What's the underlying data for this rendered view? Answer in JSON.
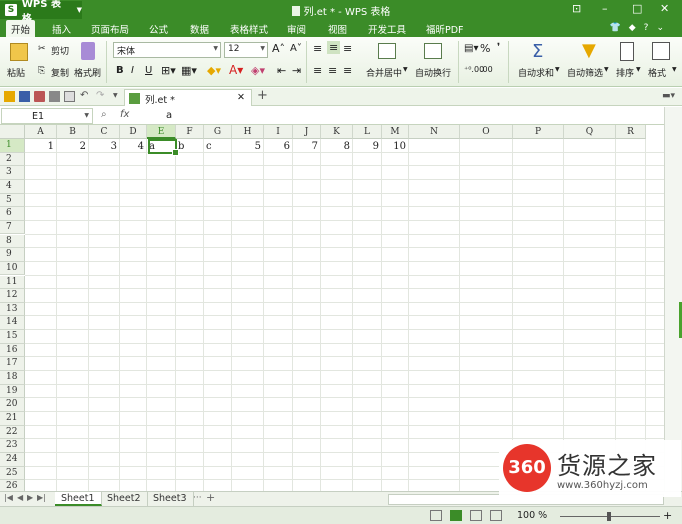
{
  "title_bar": {
    "app_name": "WPS 表格",
    "logo_glyph": "S",
    "document_title": "列.et * - WPS 表格"
  },
  "menu": {
    "tabs": [
      "开始",
      "插入",
      "页面布局",
      "公式",
      "数据",
      "表格样式",
      "审阅",
      "视图",
      "开发工具",
      "福昕PDF"
    ],
    "active_tab": "开始"
  },
  "ribbon": {
    "paste": "粘贴",
    "cut": "剪切",
    "copy": "复制",
    "format_painter": "格式刷",
    "font_name": "宋体",
    "font_size": "12",
    "bold": "B",
    "italic": "I",
    "underline": "U",
    "merge_center": "合并居中",
    "wrap_text": "自动换行",
    "percent": "%",
    "autosum": "自动求和",
    "autofilter": "自动筛选",
    "sort": "排序",
    "format": "格式"
  },
  "quick_access": {
    "doc_tab": "列.et *"
  },
  "formula_bar": {
    "name_box": "E1",
    "fx": "fx",
    "value": "a"
  },
  "grid": {
    "columns": [
      "A",
      "B",
      "C",
      "D",
      "E",
      "F",
      "G",
      "H",
      "I",
      "J",
      "K",
      "L",
      "M",
      "N",
      "O",
      "P",
      "Q",
      "R"
    ],
    "rows": [
      "1",
      "2",
      "3",
      "4",
      "5",
      "6",
      "7",
      "8",
      "9",
      "10",
      "11",
      "12",
      "13",
      "14",
      "15",
      "16",
      "17",
      "18",
      "19",
      "20",
      "21",
      "22",
      "23",
      "24",
      "25",
      "26"
    ],
    "row1": {
      "A": "1",
      "B": "2",
      "C": "3",
      "D": "4",
      "E": "a",
      "F": "b",
      "G": "c",
      "H": "5",
      "I": "6",
      "J": "7",
      "K": "8",
      "L": "9",
      "M": "10"
    },
    "selected_cell": "E1"
  },
  "sheets": {
    "tabs": [
      "Sheet1",
      "Sheet2",
      "Sheet3"
    ],
    "active": "Sheet1"
  },
  "status_bar": {
    "zoom": "100 %"
  },
  "watermark": {
    "badge": "360",
    "name": "货源之家",
    "url": "www.360hyzj.com"
  },
  "colors": {
    "accent": "#3b8c28",
    "watermark_red": "#e7352b"
  }
}
